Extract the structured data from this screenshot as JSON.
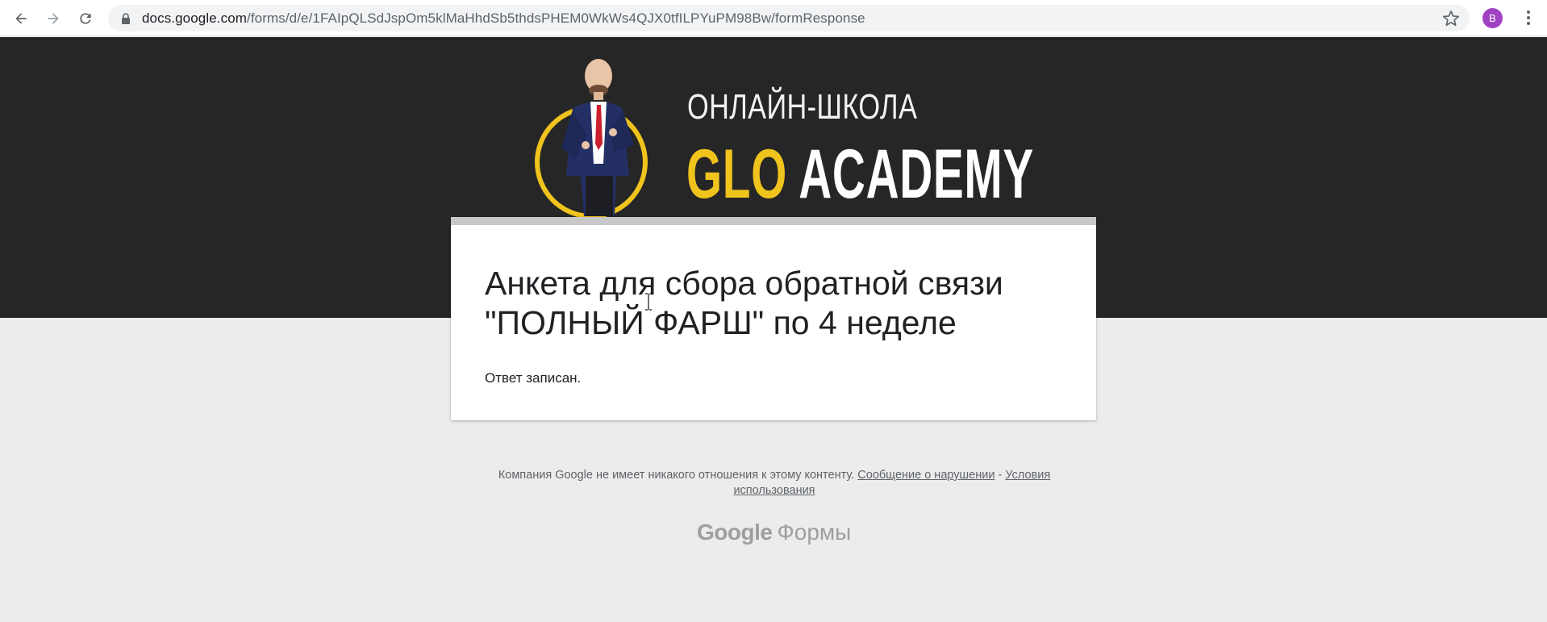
{
  "browser": {
    "url_host": "docs.google.com",
    "url_path": "/forms/d/e/1FAIpQLSdJspOm5klMaHhdSb5thdsPHEM0WkWs4QJX0tfILPYuPM98Bw/formResponse",
    "profile_initial": "B",
    "profile_color": "#a142c4",
    "icons": [
      "back-arrow-icon",
      "forward-arrow-icon",
      "reload-icon",
      "lock-icon",
      "star-icon",
      "kebab-menu-icon"
    ]
  },
  "header": {
    "school_line": "ОНЛАЙН-ШКОЛА",
    "brand_part1": "GLO",
    "brand_part2": "ACADEMY",
    "accent_color": "#f0c31d",
    "background_color": "#262626"
  },
  "form": {
    "title": "Анкета для сбора обратной связи \"ПОЛНЫЙ ФАРШ\" по 4 неделе",
    "confirmation": "Ответ записан."
  },
  "footer": {
    "disclaimer": "Компания Google не имеет никакого отношения к этому контенту.",
    "report_link": "Сообщение о нарушении",
    "separator": "-",
    "terms_link": "Условия использования",
    "logo_google": "Google",
    "logo_forms": "Формы"
  }
}
